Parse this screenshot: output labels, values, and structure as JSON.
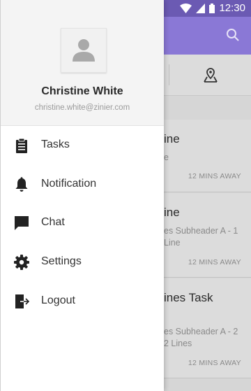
{
  "status_bar": {
    "time": "12:30"
  },
  "background": {
    "cards": [
      {
        "title": "ine",
        "subtitle": "e",
        "distance": "12 MINS AWAY"
      },
      {
        "title": "ine",
        "subtitle": "es Subheader A - 1",
        "subtitle2": "Line",
        "distance": "12 MINS AWAY"
      },
      {
        "title": "ines Task",
        "subtitle": "es Subheader A - 2",
        "subtitle2": "2 Lines",
        "distance": "12 MINS AWAY"
      }
    ]
  },
  "drawer": {
    "user": {
      "name": "Christine White",
      "email": "christine.white@zinier.com"
    },
    "menu": [
      {
        "label": "Tasks",
        "icon": "clipboard-icon"
      },
      {
        "label": "Notification",
        "icon": "bell-icon"
      },
      {
        "label": "Chat",
        "icon": "chat-icon"
      },
      {
        "label": "Settings",
        "icon": "gear-icon"
      },
      {
        "label": "Logout",
        "icon": "logout-icon"
      }
    ]
  }
}
